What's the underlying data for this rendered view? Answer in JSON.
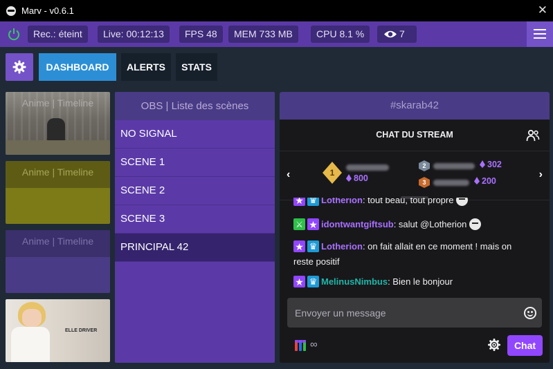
{
  "window": {
    "title": "Marv - v0.6.1",
    "close_label": "✕"
  },
  "statusbar": {
    "recording": "Rec.: éteint",
    "live": "Live: 00:12:13",
    "fps": "FPS 48",
    "mem": "MEM 733 MB",
    "cpu": "CPU 8.1 %",
    "viewers": "7"
  },
  "nav": {
    "tabs": [
      "DASHBOARD",
      "ALERTS",
      "STATS"
    ],
    "active": "DASHBOARD"
  },
  "tiles": [
    {
      "label": "Anime | Timeline",
      "kind": "image-industrial"
    },
    {
      "label": "Anime | Timeline",
      "color": "#7d7a18"
    },
    {
      "label": "Anime | Timeline",
      "color": "#4a3b86"
    },
    {
      "label": "ELLE DRIVER",
      "kind": "image-nurse"
    }
  ],
  "scenes": {
    "title": "OBS | Liste des scènes",
    "items": [
      "NO SIGNAL",
      "SCENE 1",
      "SCENE 2",
      "SCENE 3",
      "PRINCIPAL 42"
    ],
    "active_index": 4
  },
  "chat": {
    "channel": "#skarab42",
    "header": "CHAT DU STREAM",
    "leaderboard": [
      {
        "rank": "1",
        "bits": "800"
      },
      {
        "rank": "2",
        "bits": "302"
      },
      {
        "rank": "3",
        "bits": "200"
      }
    ],
    "messages": [
      {
        "badges": [
          "star",
          "crown"
        ],
        "user": "Lotherion",
        "color": "#a970ff",
        "text": ": tout beau, tout propre",
        "emote": true
      },
      {
        "badges": [
          "sword",
          "star"
        ],
        "user": "idontwantgiftsub",
        "color": "#a970ff",
        "text": ": salut @Lotherion",
        "emote": true
      },
      {
        "badges": [
          "star",
          "crown"
        ],
        "user": "Lotherion",
        "color": "#a970ff",
        "text": ": on fait allait en ce moment ! mais on reste positif",
        "emote": false
      },
      {
        "badges": [
          "star",
          "crown"
        ],
        "user": "MelinusNimbus",
        "color": "#1fb5a8",
        "text": ": Bien le bonjour",
        "emote": false
      }
    ],
    "input_placeholder": "Envoyer un message",
    "infinity": "∞",
    "send_label": "Chat"
  }
}
